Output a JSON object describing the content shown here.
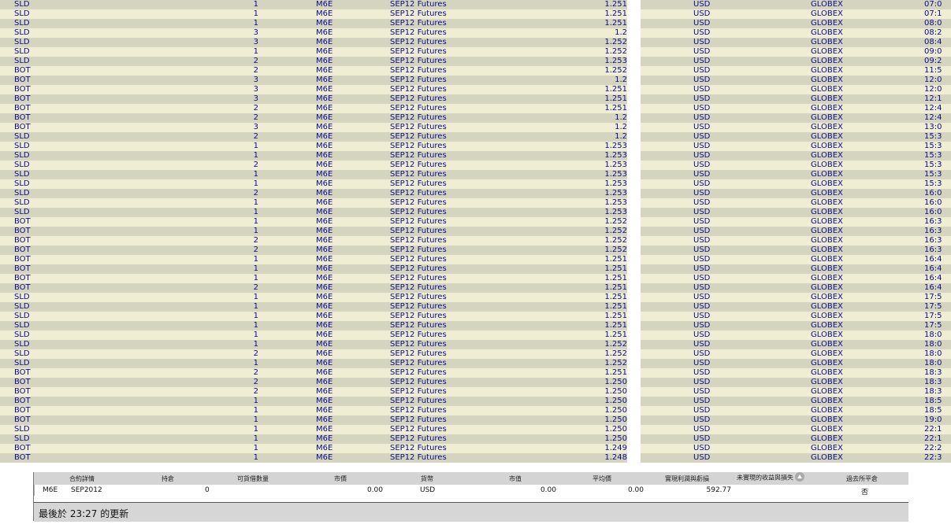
{
  "trades": [
    {
      "action": "SLD",
      "qty": "1",
      "symbol": "M6E",
      "desc": "SEP12 Futures",
      "price": "1.251",
      "currency": "USD",
      "exchange": "GLOBEX",
      "time": "07:0"
    },
    {
      "action": "SLD",
      "qty": "1",
      "symbol": "M6E",
      "desc": "SEP12 Futures",
      "price": "1.251",
      "currency": "USD",
      "exchange": "GLOBEX",
      "time": "07:1"
    },
    {
      "action": "SLD",
      "qty": "1",
      "symbol": "M6E",
      "desc": "SEP12 Futures",
      "price": "1.251",
      "currency": "USD",
      "exchange": "GLOBEX",
      "time": "08:0"
    },
    {
      "action": "SLD",
      "qty": "3",
      "symbol": "M6E",
      "desc": "SEP12 Futures",
      "price": "1.2",
      "currency": "USD",
      "exchange": "GLOBEX",
      "time": "08:2"
    },
    {
      "action": "SLD",
      "qty": "3",
      "symbol": "M6E",
      "desc": "SEP12 Futures",
      "price": "1.252",
      "currency": "USD",
      "exchange": "GLOBEX",
      "time": "08:4"
    },
    {
      "action": "SLD",
      "qty": "1",
      "symbol": "M6E",
      "desc": "SEP12 Futures",
      "price": "1.252",
      "currency": "USD",
      "exchange": "GLOBEX",
      "time": "09:0"
    },
    {
      "action": "SLD",
      "qty": "2",
      "symbol": "M6E",
      "desc": "SEP12 Futures",
      "price": "1.253",
      "currency": "USD",
      "exchange": "GLOBEX",
      "time": "09:2"
    },
    {
      "action": "BOT",
      "qty": "2",
      "symbol": "M6E",
      "desc": "SEP12 Futures",
      "price": "1.252",
      "currency": "USD",
      "exchange": "GLOBEX",
      "time": "11:5"
    },
    {
      "action": "BOT",
      "qty": "3",
      "symbol": "M6E",
      "desc": "SEP12 Futures",
      "price": "1.2",
      "currency": "USD",
      "exchange": "GLOBEX",
      "time": "12:0"
    },
    {
      "action": "BOT",
      "qty": "3",
      "symbol": "M6E",
      "desc": "SEP12 Futures",
      "price": "1.251",
      "currency": "USD",
      "exchange": "GLOBEX",
      "time": "12:0"
    },
    {
      "action": "BOT",
      "qty": "3",
      "symbol": "M6E",
      "desc": "SEP12 Futures",
      "price": "1.251",
      "currency": "USD",
      "exchange": "GLOBEX",
      "time": "12:1"
    },
    {
      "action": "BOT",
      "qty": "2",
      "symbol": "M6E",
      "desc": "SEP12 Futures",
      "price": "1.251",
      "currency": "USD",
      "exchange": "GLOBEX",
      "time": "12:4"
    },
    {
      "action": "BOT",
      "qty": "2",
      "symbol": "M6E",
      "desc": "SEP12 Futures",
      "price": "1.2",
      "currency": "USD",
      "exchange": "GLOBEX",
      "time": "12:4"
    },
    {
      "action": "BOT",
      "qty": "3",
      "symbol": "M6E",
      "desc": "SEP12 Futures",
      "price": "1.2",
      "currency": "USD",
      "exchange": "GLOBEX",
      "time": "13:0"
    },
    {
      "action": "SLD",
      "qty": "2",
      "symbol": "M6E",
      "desc": "SEP12 Futures",
      "price": "1.2",
      "currency": "USD",
      "exchange": "GLOBEX",
      "time": "15:3"
    },
    {
      "action": "SLD",
      "qty": "1",
      "symbol": "M6E",
      "desc": "SEP12 Futures",
      "price": "1.253",
      "currency": "USD",
      "exchange": "GLOBEX",
      "time": "15:3"
    },
    {
      "action": "SLD",
      "qty": "1",
      "symbol": "M6E",
      "desc": "SEP12 Futures",
      "price": "1.253",
      "currency": "USD",
      "exchange": "GLOBEX",
      "time": "15:3"
    },
    {
      "action": "SLD",
      "qty": "2",
      "symbol": "M6E",
      "desc": "SEP12 Futures",
      "price": "1.253",
      "currency": "USD",
      "exchange": "GLOBEX",
      "time": "15:3"
    },
    {
      "action": "SLD",
      "qty": "1",
      "symbol": "M6E",
      "desc": "SEP12 Futures",
      "price": "1.253",
      "currency": "USD",
      "exchange": "GLOBEX",
      "time": "15:3"
    },
    {
      "action": "SLD",
      "qty": "1",
      "symbol": "M6E",
      "desc": "SEP12 Futures",
      "price": "1.253",
      "currency": "USD",
      "exchange": "GLOBEX",
      "time": "15:3"
    },
    {
      "action": "SLD",
      "qty": "2",
      "symbol": "M6E",
      "desc": "SEP12 Futures",
      "price": "1.253",
      "currency": "USD",
      "exchange": "GLOBEX",
      "time": "16:0"
    },
    {
      "action": "SLD",
      "qty": "1",
      "symbol": "M6E",
      "desc": "SEP12 Futures",
      "price": "1.253",
      "currency": "USD",
      "exchange": "GLOBEX",
      "time": "16:0"
    },
    {
      "action": "SLD",
      "qty": "1",
      "symbol": "M6E",
      "desc": "SEP12 Futures",
      "price": "1.253",
      "currency": "USD",
      "exchange": "GLOBEX",
      "time": "16:0"
    },
    {
      "action": "BOT",
      "qty": "1",
      "symbol": "M6E",
      "desc": "SEP12 Futures",
      "price": "1.252",
      "currency": "USD",
      "exchange": "GLOBEX",
      "time": "16:3"
    },
    {
      "action": "BOT",
      "qty": "1",
      "symbol": "M6E",
      "desc": "SEP12 Futures",
      "price": "1.252",
      "currency": "USD",
      "exchange": "GLOBEX",
      "time": "16:3"
    },
    {
      "action": "BOT",
      "qty": "2",
      "symbol": "M6E",
      "desc": "SEP12 Futures",
      "price": "1.252",
      "currency": "USD",
      "exchange": "GLOBEX",
      "time": "16:3"
    },
    {
      "action": "BOT",
      "qty": "2",
      "symbol": "M6E",
      "desc": "SEP12 Futures",
      "price": "1.252",
      "currency": "USD",
      "exchange": "GLOBEX",
      "time": "16:3"
    },
    {
      "action": "BOT",
      "qty": "1",
      "symbol": "M6E",
      "desc": "SEP12 Futures",
      "price": "1.251",
      "currency": "USD",
      "exchange": "GLOBEX",
      "time": "16:4"
    },
    {
      "action": "BOT",
      "qty": "1",
      "symbol": "M6E",
      "desc": "SEP12 Futures",
      "price": "1.251",
      "currency": "USD",
      "exchange": "GLOBEX",
      "time": "16:4"
    },
    {
      "action": "BOT",
      "qty": "1",
      "symbol": "M6E",
      "desc": "SEP12 Futures",
      "price": "1.251",
      "currency": "USD",
      "exchange": "GLOBEX",
      "time": "16:4"
    },
    {
      "action": "BOT",
      "qty": "2",
      "symbol": "M6E",
      "desc": "SEP12 Futures",
      "price": "1.251",
      "currency": "USD",
      "exchange": "GLOBEX",
      "time": "16:4"
    },
    {
      "action": "SLD",
      "qty": "1",
      "symbol": "M6E",
      "desc": "SEP12 Futures",
      "price": "1.251",
      "currency": "USD",
      "exchange": "GLOBEX",
      "time": "17:5"
    },
    {
      "action": "SLD",
      "qty": "1",
      "symbol": "M6E",
      "desc": "SEP12 Futures",
      "price": "1.251",
      "currency": "USD",
      "exchange": "GLOBEX",
      "time": "17:5"
    },
    {
      "action": "SLD",
      "qty": "1",
      "symbol": "M6E",
      "desc": "SEP12 Futures",
      "price": "1.251",
      "currency": "USD",
      "exchange": "GLOBEX",
      "time": "17:5"
    },
    {
      "action": "SLD",
      "qty": "1",
      "symbol": "M6E",
      "desc": "SEP12 Futures",
      "price": "1.251",
      "currency": "USD",
      "exchange": "GLOBEX",
      "time": "17:5"
    },
    {
      "action": "SLD",
      "qty": "1",
      "symbol": "M6E",
      "desc": "SEP12 Futures",
      "price": "1.251",
      "currency": "USD",
      "exchange": "GLOBEX",
      "time": "18:0"
    },
    {
      "action": "SLD",
      "qty": "1",
      "symbol": "M6E",
      "desc": "SEP12 Futures",
      "price": "1.252",
      "currency": "USD",
      "exchange": "GLOBEX",
      "time": "18:0"
    },
    {
      "action": "SLD",
      "qty": "2",
      "symbol": "M6E",
      "desc": "SEP12 Futures",
      "price": "1.252",
      "currency": "USD",
      "exchange": "GLOBEX",
      "time": "18:0"
    },
    {
      "action": "SLD",
      "qty": "1",
      "symbol": "M6E",
      "desc": "SEP12 Futures",
      "price": "1.252",
      "currency": "USD",
      "exchange": "GLOBEX",
      "time": "18:0"
    },
    {
      "action": "BOT",
      "qty": "2",
      "symbol": "M6E",
      "desc": "SEP12 Futures",
      "price": "1.251",
      "currency": "USD",
      "exchange": "GLOBEX",
      "time": "18:3"
    },
    {
      "action": "BOT",
      "qty": "2",
      "symbol": "M6E",
      "desc": "SEP12 Futures",
      "price": "1.250",
      "currency": "USD",
      "exchange": "GLOBEX",
      "time": "18:3"
    },
    {
      "action": "BOT",
      "qty": "2",
      "symbol": "M6E",
      "desc": "SEP12 Futures",
      "price": "1.250",
      "currency": "USD",
      "exchange": "GLOBEX",
      "time": "18:3"
    },
    {
      "action": "BOT",
      "qty": "1",
      "symbol": "M6E",
      "desc": "SEP12 Futures",
      "price": "1.250",
      "currency": "USD",
      "exchange": "GLOBEX",
      "time": "18:5"
    },
    {
      "action": "BOT",
      "qty": "1",
      "symbol": "M6E",
      "desc": "SEP12 Futures",
      "price": "1.250",
      "currency": "USD",
      "exchange": "GLOBEX",
      "time": "18:5"
    },
    {
      "action": "BOT",
      "qty": "1",
      "symbol": "M6E",
      "desc": "SEP12 Futures",
      "price": "1.250",
      "currency": "USD",
      "exchange": "GLOBEX",
      "time": "19:0"
    },
    {
      "action": "SLD",
      "qty": "1",
      "symbol": "M6E",
      "desc": "SEP12 Futures",
      "price": "1.250",
      "currency": "USD",
      "exchange": "GLOBEX",
      "time": "22:1"
    },
    {
      "action": "SLD",
      "qty": "1",
      "symbol": "M6E",
      "desc": "SEP12 Futures",
      "price": "1.250",
      "currency": "USD",
      "exchange": "GLOBEX",
      "time": "22:1"
    },
    {
      "action": "BOT",
      "qty": "1",
      "symbol": "M6E",
      "desc": "SEP12 Futures",
      "price": "1.249",
      "currency": "USD",
      "exchange": "GLOBEX",
      "time": "22:2"
    },
    {
      "action": "BOT",
      "qty": "1",
      "symbol": "M6E",
      "desc": "SEP12 Futures",
      "price": "1.248",
      "currency": "USD",
      "exchange": "GLOBEX",
      "time": "22:3"
    }
  ],
  "summary": {
    "headers": {
      "contract": "合約詳情",
      "position": "持倉",
      "available": "可貨借數量",
      "market_price": "市價",
      "currency": "貨幣",
      "market_value": "市值",
      "avg_price": "平均價",
      "realized_pnl": "實現利潤與虧損",
      "unrealized_pnl": "未實現的收益與損失",
      "closed": "過去所平倉"
    },
    "row": {
      "symbol": "M6E",
      "expiry": "SEP2012",
      "position": "0",
      "market_price": "0.00",
      "currency": "USD",
      "market_value": "0.00",
      "avg_price": "0.00",
      "realized_pnl": "592.77",
      "closed": "否"
    }
  },
  "status": {
    "last_updated": "最後於 23:27 的更新"
  },
  "icons": {
    "sort": "sort-ascending-icon"
  },
  "colors": {
    "row_dark": "#d4d4bf",
    "row_light": "#efedd4",
    "text": "#0a0a8c"
  }
}
